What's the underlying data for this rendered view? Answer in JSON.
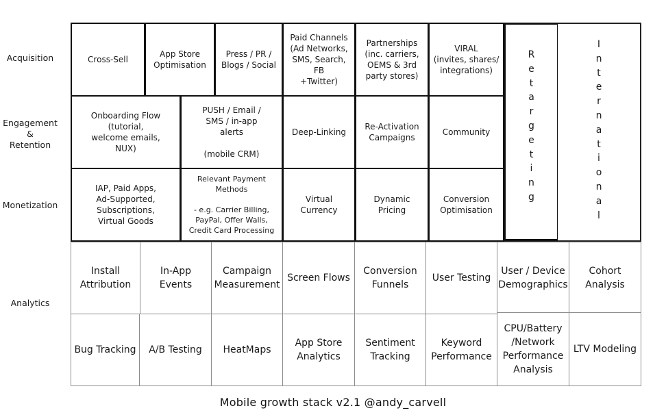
{
  "row_labels": {
    "acquisition": "Acquisition",
    "engagement": "Engagement\n&\nRetention",
    "monetization": "Monetization",
    "analytics": "Analytics"
  },
  "acquisition": [
    "Cross-Sell",
    "App Store\nOptimisation",
    "Press / PR /\nBlogs / Social",
    "Paid Channels\n(Ad Networks,\nSMS, Search, FB\n+Twitter)",
    "Partnerships\n(inc. carriers,\nOEMS & 3rd\nparty stores)",
    "VIRAL\n(invites, shares/\nintegrations)"
  ],
  "engagement": [
    "Onboarding Flow\n(tutorial,\nwelcome emails,\nNUX)",
    "PUSH / Email /\nSMS / in-app\nalerts\n\n(mobile CRM)",
    "Deep-Linking",
    "Re-Activation\nCampaigns",
    "Community"
  ],
  "monetization": [
    "IAP, Paid Apps,\nAd-Supported,\nSubscriptions,\nVirtual Goods",
    "Relevant Payment\nMethods\n\n- e.g. Carrier Billing,\nPayPal, Offer Walls,\nCredit Card Processing",
    "Virtual\nCurrency",
    "Dynamic\nPricing",
    "Conversion\nOptimisation"
  ],
  "vertical_columns": {
    "retargeting": "Retargeting",
    "international": "International"
  },
  "analytics_row1": [
    "Install\nAttribution",
    "In-App\nEvents",
    "Campaign\nMeasurement",
    "Screen Flows",
    "Conversion\nFunnels",
    "User Testing",
    "User / Device\nDemographics",
    "Cohort\nAnalysis"
  ],
  "analytics_row2": [
    "Bug Tracking",
    "A/B Testing",
    "HeatMaps",
    "App Store\nAnalytics",
    "Sentiment\nTracking",
    "Keyword\nPerformance",
    "CPU/Battery\n/Network\nPerformance\nAnalysis",
    "LTV Modeling"
  ],
  "caption": "Mobile growth stack v2.1   @andy_carvell"
}
